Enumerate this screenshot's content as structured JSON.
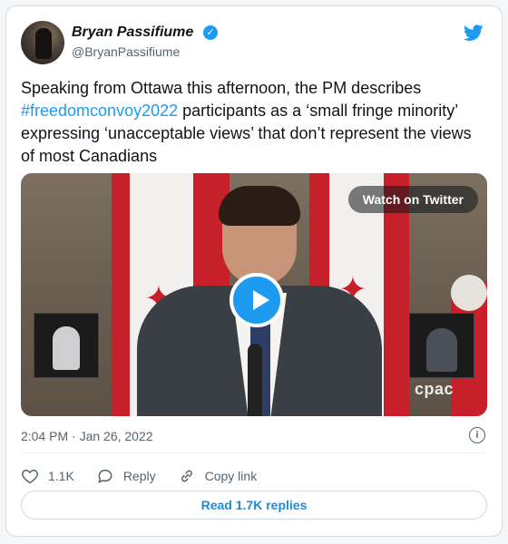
{
  "author": {
    "name": "Bryan Passifiume",
    "handle": "@BryanPassifiume",
    "verified": true,
    "avatar": "avatar-silhouette"
  },
  "tweet": {
    "text_before": "Speaking from Ottawa this afternoon, the PM describes ",
    "hashtag": "#freedomconvoy2022",
    "text_after": " participants as a ‘small fringe minority’  expressing ‘unacceptable views’ that don’t represent the views of most Canadians"
  },
  "media": {
    "watch_label": "Watch on Twitter",
    "watermark": "cpac",
    "icons": [
      "play-icon"
    ]
  },
  "meta": {
    "timestamp": "2:04 PM · Jan 26, 2022"
  },
  "actions": {
    "like_count": "1.1K",
    "reply_label": "Reply",
    "copy_label": "Copy link"
  },
  "footer": {
    "read_replies": "Read 1.7K replies"
  },
  "colors": {
    "accent": "#1d9bf0",
    "text": "#0f1419",
    "muted": "#536471"
  }
}
